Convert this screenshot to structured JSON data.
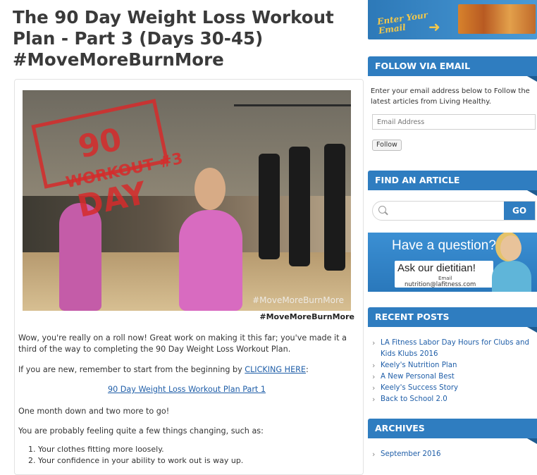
{
  "post": {
    "title": "The 90 Day Weight Loss Workout Plan - Part 3 (Days 30-45) #MoveMoreBurnMore",
    "image": {
      "stamp_text": "90 DAY",
      "stamp_sub": "WORKOUT #3",
      "watermark": "#MoveMoreBurnMore",
      "caption": "#MoveMoreBurnMore"
    },
    "para1": "Wow, you're really on a roll now! Great work on making it this far; you've made it a third of the way to completing the 90 Day Weight Loss Workout Plan.",
    "para2_prefix": "If you are new, remember to start from the beginning by ",
    "para2_link": "CLICKING HERE",
    "para2_suffix": ":",
    "part1_link": "90 Day Weight Loss Workout Plan Part 1",
    "para3": "One month down and two more to go!",
    "para4": "You are probably feeling quite a few things changing, such as:",
    "list": [
      "1.  Your clothes fitting more loosely.",
      "2.  Your confidence in your ability to work out is way up."
    ]
  },
  "sidebar": {
    "banner": {
      "enter_line1": "Enter Your",
      "enter_line2": "Email"
    },
    "follow": {
      "heading": "FOLLOW VIA EMAIL",
      "text": "Enter your email address below to Follow the latest articles from Living Healthy.",
      "placeholder": "Email Address",
      "button": "Follow"
    },
    "find": {
      "heading": "FIND AN ARTICLE",
      "go": "GO"
    },
    "question": {
      "title": "Have a question?",
      "ask": "Ask our dietitian!",
      "email_label": "Email",
      "email": "nutrition@lafitness.com"
    },
    "recent": {
      "heading": "RECENT POSTS",
      "items": [
        "LA Fitness Labor Day Hours for Clubs and Kids Klubs 2016",
        "Keely's Nutrition Plan",
        "A New Personal Best",
        "Keely's Success Story",
        "Back to School 2.0"
      ]
    },
    "archives": {
      "heading": "ARCHIVES",
      "items": [
        "September 2016"
      ]
    }
  }
}
